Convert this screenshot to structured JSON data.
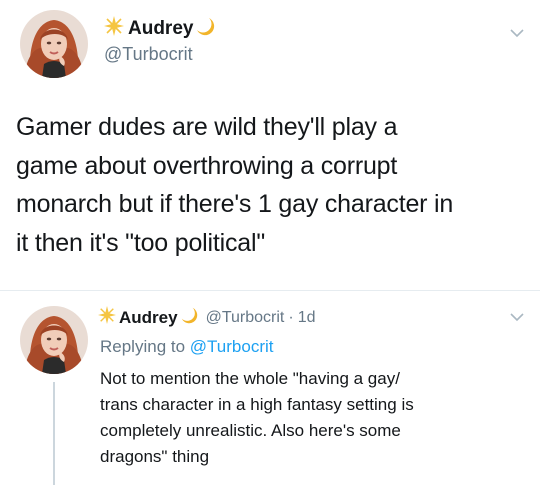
{
  "main_tweet": {
    "author": {
      "display_name": "Audrey",
      "handle": "@Turbocrit",
      "name_emojis": [
        "sparkle-star-icon",
        "crescent-moon-icon"
      ]
    },
    "text_lines": [
      "Gamer dudes are wild they'll play a",
      "game about overthrowing a corrupt",
      "monarch but if there's 1 gay character in",
      "it then it's \"too political\""
    ]
  },
  "reply_tweet": {
    "author": {
      "display_name": "Audrey",
      "handle": "@Turbocrit",
      "time": "1d",
      "separator": "·"
    },
    "replying_to": {
      "prefix": "Replying to",
      "mention": "@Turbocrit"
    },
    "text_lines": [
      "Not to mention the whole \"having a gay/",
      "trans character in a high fantasy setting is",
      "completely unrealistic. Also here's some",
      "dragons\" thing"
    ]
  },
  "colors": {
    "text": "#14171a",
    "secondary_text": "#657786",
    "link": "#1da1f2",
    "divider": "#e6ecf0",
    "star": "#f5c542",
    "moon": "#f2b52b"
  }
}
